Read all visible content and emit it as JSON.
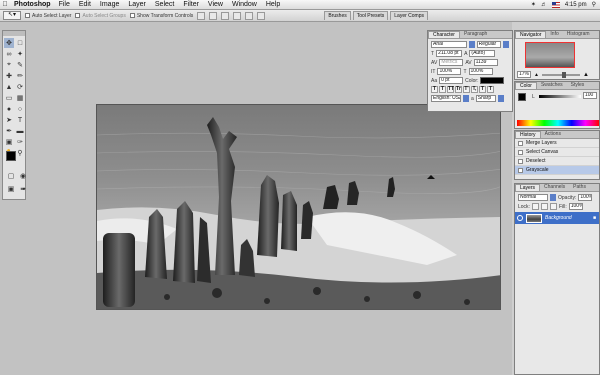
{
  "menubar": {
    "app_name": "Photoshop",
    "items": [
      "File",
      "Edit",
      "Image",
      "Layer",
      "Select",
      "Filter",
      "View",
      "Window",
      "Help"
    ],
    "clock": "4:15 pm"
  },
  "options_bar": {
    "auto_select_layer": "Auto Select Layer",
    "auto_select_groups": "Auto Select Groups",
    "show_transform_controls": "Show Transform Controls"
  },
  "palette_well": {
    "tabs": [
      "Brushes",
      "Tool Presets",
      "Layer Comps"
    ]
  },
  "character_panel": {
    "tabs": [
      "Character",
      "Paragraph"
    ],
    "font_family": "Arial",
    "font_style": "Regular",
    "font_size": "211.08 pt",
    "leading": "(Auto)",
    "kerning": "Metrics",
    "tracking": "1139",
    "vertical_scale": "100%",
    "horizontal_scale": "100%",
    "baseline_shift": "0 pt",
    "color_label": "Color:",
    "language": "English: USA",
    "antialias_label": "a",
    "antialias": "Sharp",
    "type_buttons": [
      "T",
      "T",
      "TT",
      "Tr",
      "T'",
      "T,",
      "T",
      "T"
    ]
  },
  "navigator_panel": {
    "tabs": [
      "Navigator",
      "Info",
      "Histogram"
    ],
    "zoom": "17%"
  },
  "color_panel": {
    "tabs": [
      "Color",
      "Swatches",
      "Styles"
    ],
    "channel": "L",
    "value": "100"
  },
  "history_panel": {
    "tabs": [
      "History",
      "Actions"
    ],
    "items": [
      "Merge Layers",
      "Select Canvas",
      "Deselect",
      "Grayscale"
    ],
    "selected_index": 3
  },
  "layers_panel": {
    "tabs": [
      "Layers",
      "Channels",
      "Paths"
    ],
    "blend_mode": "Normal",
    "opacity_label": "Opacity:",
    "opacity": "100%",
    "lock_label": "Lock:",
    "fill_label": "Fill:",
    "fill": "100%",
    "layer_name": "Background"
  },
  "colors": {
    "foreground": "#000000",
    "background": "#ffffff",
    "selection_blue": "#3e6fc8"
  }
}
